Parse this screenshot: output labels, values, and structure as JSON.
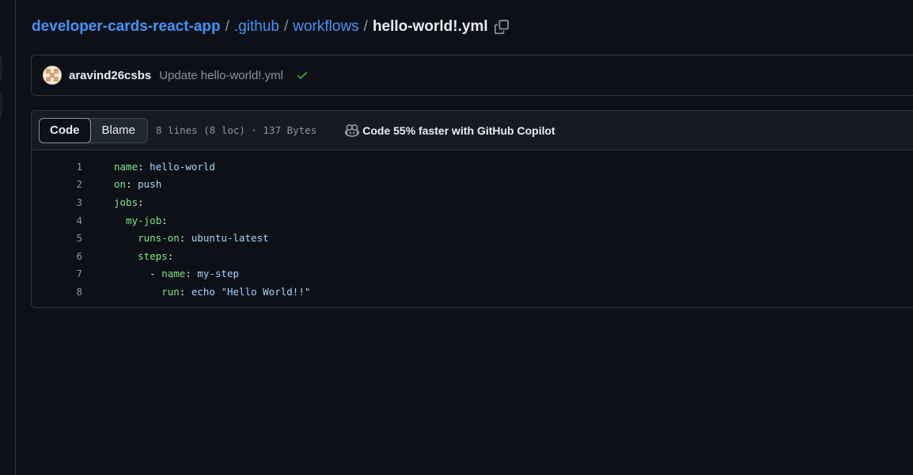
{
  "breadcrumb": {
    "repo": "developer-cards-react-app",
    "sep": "/",
    "dir1": ".github",
    "dir2": "workflows",
    "file": "hello-world!.yml"
  },
  "commit": {
    "author": "aravind26csbs",
    "message": "Update hello-world!.yml",
    "status_color": "#3fb950"
  },
  "file_header": {
    "tabs": [
      "Code",
      "Blame"
    ],
    "active_tab": "Code",
    "info": "8 lines (8 loc) · 137 Bytes",
    "copilot_text": "Code 55% faster with GitHub Copilot"
  },
  "code_lines": [
    {
      "n": "1",
      "indent": "",
      "dash": "",
      "key": "name",
      "colon": ":",
      "value": " hello-world"
    },
    {
      "n": "2",
      "indent": "",
      "dash": "",
      "key": "on",
      "colon": ":",
      "value": " push"
    },
    {
      "n": "3",
      "indent": "",
      "dash": "",
      "key": "jobs",
      "colon": ":",
      "value": ""
    },
    {
      "n": "4",
      "indent": "  ",
      "dash": "",
      "key": "my-job",
      "colon": ":",
      "value": ""
    },
    {
      "n": "5",
      "indent": "    ",
      "dash": "",
      "key": "runs-on",
      "colon": ":",
      "value": " ubuntu-latest"
    },
    {
      "n": "6",
      "indent": "    ",
      "dash": "",
      "key": "steps",
      "colon": ":",
      "value": ""
    },
    {
      "n": "7",
      "indent": "      ",
      "dash": "- ",
      "key": "name",
      "colon": ":",
      "value": " my-step"
    },
    {
      "n": "8",
      "indent": "        ",
      "dash": "",
      "key": "run",
      "colon": ":",
      "value": " echo \"Hello World!!\""
    }
  ],
  "colors": {
    "background": "#0d1117",
    "link": "#4493f8",
    "yaml_key": "#7ee787",
    "yaml_value": "#a5d6ff",
    "muted": "#8b949e"
  }
}
